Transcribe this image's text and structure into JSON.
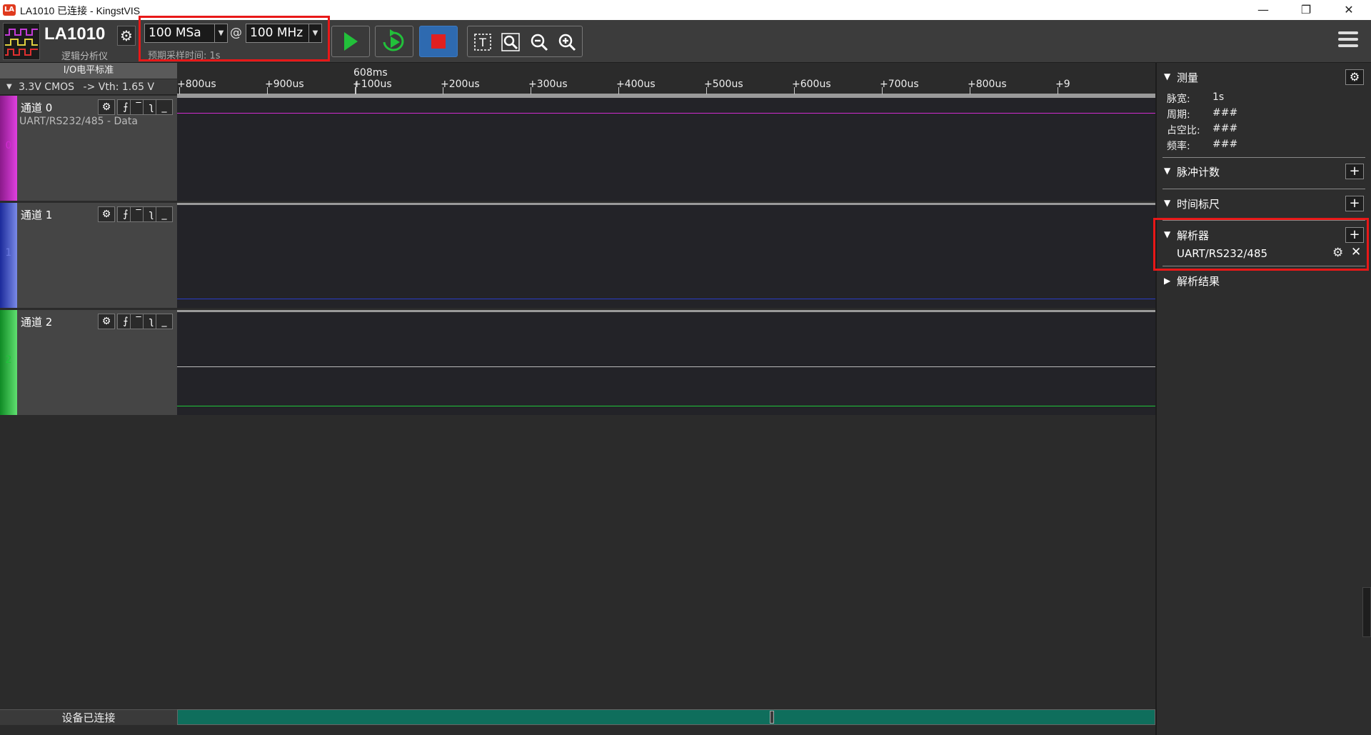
{
  "window": {
    "icon_label": "LA",
    "title": "LA1010 已连接 - KingstVIS",
    "minimize": "—",
    "restore": "❐",
    "close": "✕"
  },
  "toolbar": {
    "device_name": "LA1010",
    "device_subtitle": "逻辑分析仪",
    "sample_count": "100 MSa",
    "at": "@",
    "sample_rate": "100 MHz",
    "expected_time": "预期采样时间: 1s",
    "colors": {
      "start": "#22c03a",
      "stop": "#e02020",
      "accent": "#2e6ab0"
    }
  },
  "io": {
    "header": "I/O电平标准",
    "standard": "3.3V CMOS",
    "vth": "-> Vth: 1.65 V"
  },
  "ruler": {
    "cursor_label": "608ms",
    "ticks": [
      "+800us",
      "+900us",
      "+100us",
      "+200us",
      "+300us",
      "+400us",
      "+500us",
      "+600us",
      "+700us",
      "+800us",
      "+9"
    ]
  },
  "channels": [
    {
      "name": "通道 0",
      "index": "0",
      "decoder": "UART/RS232/485 - Data",
      "color": "#d12bd1"
    },
    {
      "name": "通道 1",
      "index": "1",
      "decoder": "",
      "color": "#2a3cc8"
    },
    {
      "name": "通道 2",
      "index": "2",
      "decoder": "",
      "color": "#1fc63b"
    }
  ],
  "status": {
    "device_status": "设备已连接"
  },
  "panel": {
    "measure": {
      "title": "测量",
      "rows": [
        {
          "label": "脉宽:",
          "value": "1s"
        },
        {
          "label": "周期:",
          "value": "###"
        },
        {
          "label": "占空比:",
          "value": "###"
        },
        {
          "label": "频率:",
          "value": "###"
        }
      ]
    },
    "pulse_count": {
      "title": "脉冲计数"
    },
    "time_ruler": {
      "title": "时间标尺"
    },
    "decoders": {
      "title": "解析器",
      "items": [
        "UART/RS232/485"
      ]
    },
    "decode_results": {
      "title": "解析结果"
    }
  }
}
